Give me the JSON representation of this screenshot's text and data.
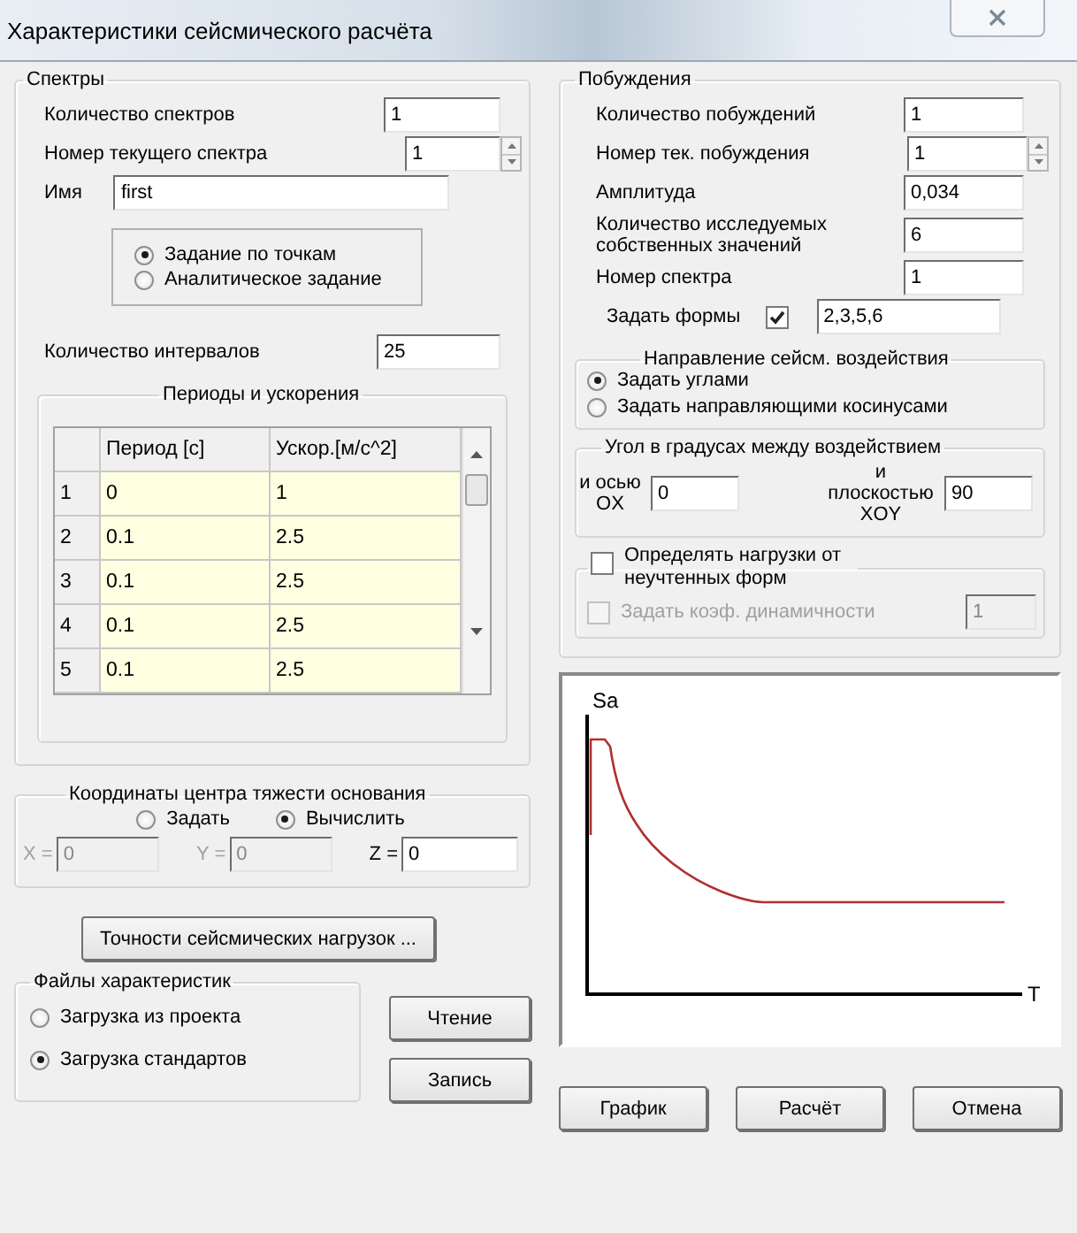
{
  "window": {
    "title": "Характеристики сейсмического расчёта"
  },
  "spectra": {
    "title": "Спектры",
    "fields": [
      {
        "label": "Количество спектров",
        "value": "1",
        "kind": "text"
      },
      {
        "label": "Номер текущего спектра",
        "value": "1",
        "kind": "spin"
      },
      {
        "label": "Имя",
        "value": "first",
        "kind": "wide"
      }
    ],
    "mode_options": [
      {
        "label": "Задание по точкам",
        "selected": true
      },
      {
        "label": "Аналитическое задание",
        "selected": false
      }
    ],
    "intervals": {
      "label": "Количество интервалов",
      "value": "25"
    },
    "table": {
      "title": "Периоды и ускорения",
      "columns": [
        "Период [с]",
        "Ускор.[м/с^2]"
      ],
      "rows": [
        {
          "index": "1",
          "cells": [
            "0",
            "1"
          ]
        },
        {
          "index": "2",
          "cells": [
            "0.1",
            "2.5"
          ]
        },
        {
          "index": "3",
          "cells": [
            "0.1",
            "2.5"
          ]
        },
        {
          "index": "4",
          "cells": [
            "0.1",
            "2.5"
          ]
        },
        {
          "index": "5",
          "cells": [
            "0.1",
            "2.5"
          ]
        }
      ]
    }
  },
  "base_center": {
    "title": "Координаты центра тяжести основания",
    "options": [
      {
        "label": "Задать",
        "selected": false
      },
      {
        "label": "Вычислить",
        "selected": true
      }
    ],
    "fields": [
      {
        "label": "X =",
        "value": "0",
        "disabled": true
      },
      {
        "label": "Y =",
        "value": "0",
        "disabled": true
      },
      {
        "label": "Z =",
        "value": "0",
        "disabled": false
      }
    ]
  },
  "precision_button": "Точности сейсмических нагрузок ...",
  "files": {
    "title": "Файлы характеристик",
    "options": [
      {
        "label": "Загрузка из проекта",
        "selected": false
      },
      {
        "label": "Загрузка стандартов",
        "selected": true
      }
    ],
    "buttons": [
      "Чтение",
      "Запись"
    ]
  },
  "excitations": {
    "title": "Побуждения",
    "fields": [
      {
        "label": "Количество побуждений",
        "value": "1",
        "kind": "text"
      },
      {
        "label": "Номер тек. побуждения",
        "value": "1",
        "kind": "spin"
      },
      {
        "label": "Амплитуда",
        "value": "0,034",
        "kind": "text"
      },
      {
        "label": "Количество исследуемых собственных значений",
        "value": "6",
        "kind": "text"
      },
      {
        "label": "Номер спектра",
        "value": "1",
        "kind": "text"
      }
    ],
    "forms": {
      "label": "Задать формы",
      "checked": true,
      "value": "2,3,5,6"
    },
    "direction": {
      "title": "Направление сейсм. воздействия",
      "options": [
        {
          "label": "Задать углами",
          "selected": true
        },
        {
          "label": "Задать направляющими косинусами",
          "selected": false
        }
      ]
    },
    "angle": {
      "title": "Угол в градусах между воздействием",
      "fields": [
        {
          "label": "и осью OX",
          "value": "0"
        },
        {
          "label": "и плоскостью XOY",
          "value": "90"
        }
      ]
    },
    "unaccounted": {
      "label": "Определять нагрузки от неучтенных форм",
      "checked": false,
      "dynamic": {
        "label": "Задать коэф. динамичности",
        "checked": false,
        "disabled": true,
        "value": "1"
      }
    }
  },
  "plot": {
    "y_axis_label": "Sa",
    "x_axis_label": "T"
  },
  "buttons": [
    "График",
    "Расчёт",
    "Отмена"
  ]
}
